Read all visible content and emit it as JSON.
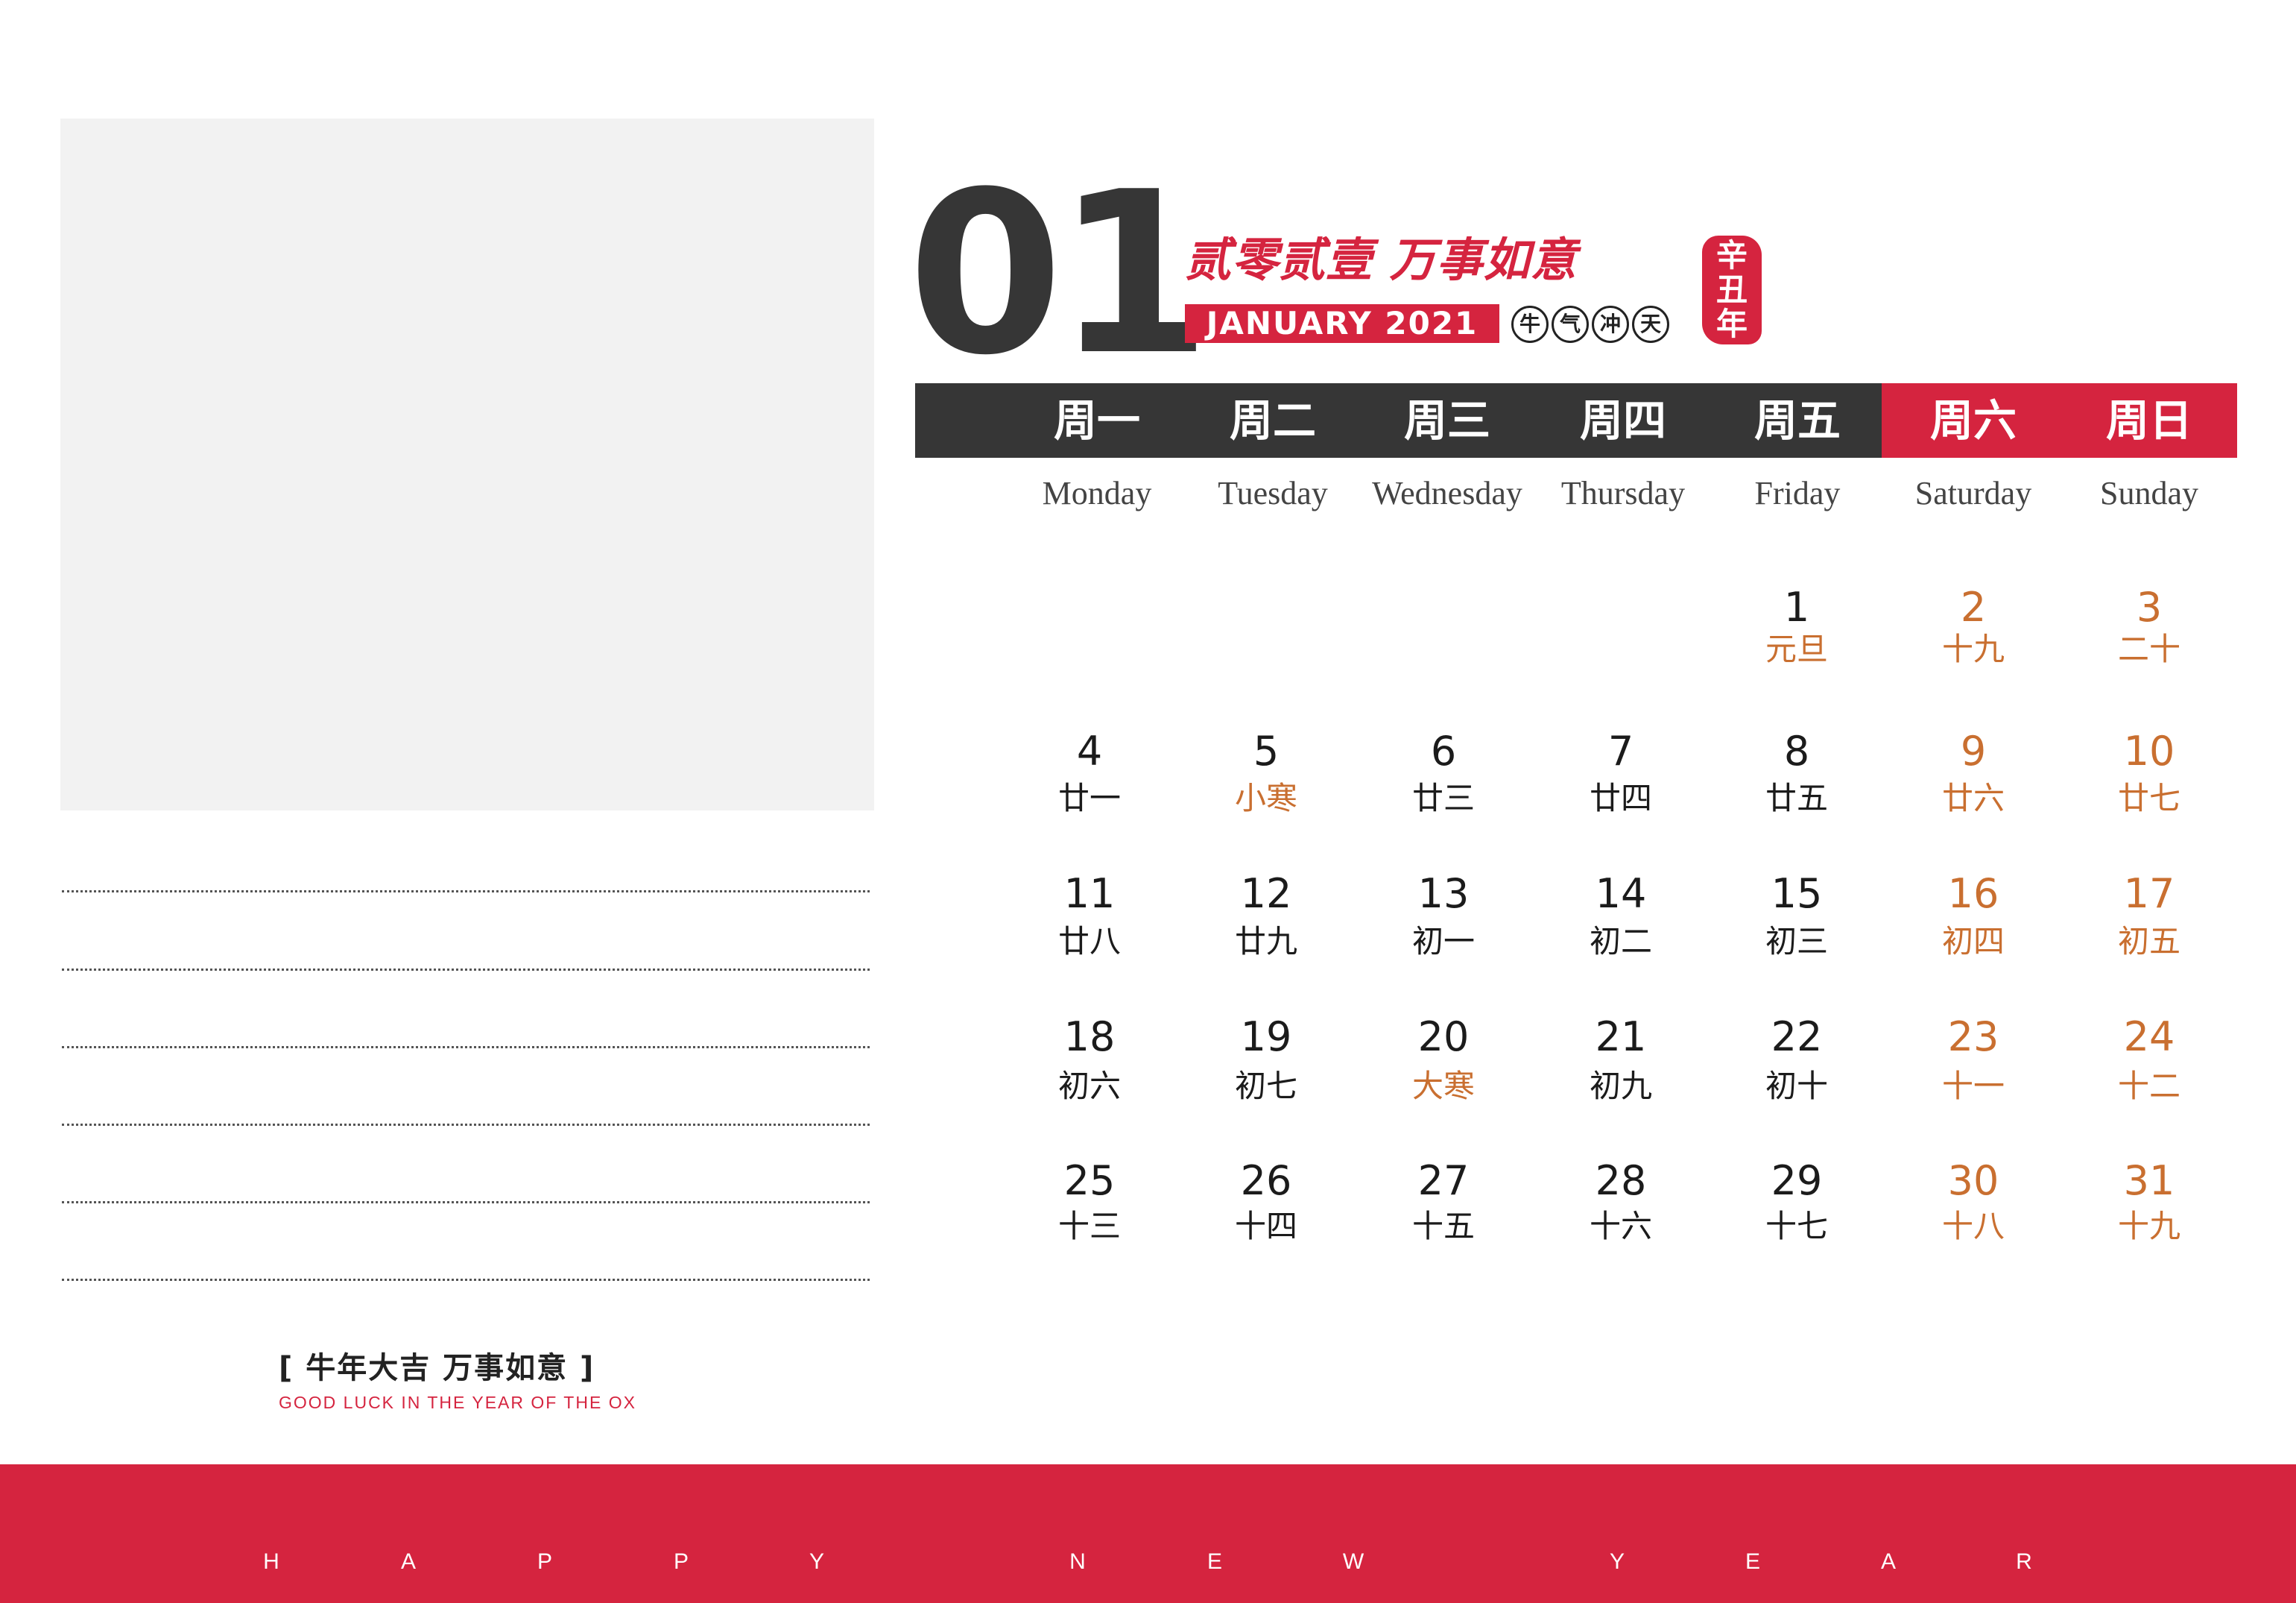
{
  "month_number": "01",
  "header": {
    "slogan": "贰零贰壹 万事如意",
    "month_label": "JANUARY 2021",
    "tags": [
      "牛",
      "气",
      "冲",
      "天"
    ],
    "seal": [
      "辛",
      "丑",
      "年"
    ]
  },
  "weekdays_cn": [
    "周一",
    "周二",
    "周三",
    "周四",
    "周五",
    "周六",
    "周日"
  ],
  "weekdays_en": [
    "Monday",
    "Tuesday",
    "Wednesday",
    "Thursday",
    "Friday",
    "Saturday",
    "Sunday"
  ],
  "weeks": [
    [
      null,
      null,
      null,
      null,
      {
        "day": "1",
        "lunar": "元旦",
        "festival": true
      },
      {
        "day": "2",
        "lunar": "十九"
      },
      {
        "day": "3",
        "lunar": "二十"
      }
    ],
    [
      {
        "day": "4",
        "lunar": "廿一"
      },
      {
        "day": "5",
        "lunar": "小寒",
        "festival": true
      },
      {
        "day": "6",
        "lunar": "廿三"
      },
      {
        "day": "7",
        "lunar": "廿四"
      },
      {
        "day": "8",
        "lunar": "廿五"
      },
      {
        "day": "9",
        "lunar": "廿六"
      },
      {
        "day": "10",
        "lunar": "廿七"
      }
    ],
    [
      {
        "day": "11",
        "lunar": "廿八"
      },
      {
        "day": "12",
        "lunar": "廿九"
      },
      {
        "day": "13",
        "lunar": "初一"
      },
      {
        "day": "14",
        "lunar": "初二"
      },
      {
        "day": "15",
        "lunar": "初三"
      },
      {
        "day": "16",
        "lunar": "初四"
      },
      {
        "day": "17",
        "lunar": "初五"
      }
    ],
    [
      {
        "day": "18",
        "lunar": "初六"
      },
      {
        "day": "19",
        "lunar": "初七"
      },
      {
        "day": "20",
        "lunar": "大寒",
        "festival": true
      },
      {
        "day": "21",
        "lunar": "初九"
      },
      {
        "day": "22",
        "lunar": "初十"
      },
      {
        "day": "23",
        "lunar": "十一"
      },
      {
        "day": "24",
        "lunar": "十二"
      }
    ],
    [
      {
        "day": "25",
        "lunar": "十三"
      },
      {
        "day": "26",
        "lunar": "十四"
      },
      {
        "day": "27",
        "lunar": "十五"
      },
      {
        "day": "28",
        "lunar": "十六"
      },
      {
        "day": "29",
        "lunar": "十七"
      },
      {
        "day": "30",
        "lunar": "十八"
      },
      {
        "day": "31",
        "lunar": "十九"
      }
    ]
  ],
  "footer": {
    "slogan_cn": "[ 牛年大吉  万事如意 ]",
    "slogan_en": "GOOD LUCK IN THE YEAR OF THE OX",
    "band_letters": [
      "H",
      "A",
      "P",
      "P",
      "Y",
      "N",
      "E",
      "W",
      "Y",
      "E",
      "A",
      "R"
    ]
  },
  "colors": {
    "accent_red": "#d5243f",
    "dark_bar": "#363636",
    "weekend_text": "#c96f30",
    "photo_placeholder": "#f2f2f2"
  }
}
